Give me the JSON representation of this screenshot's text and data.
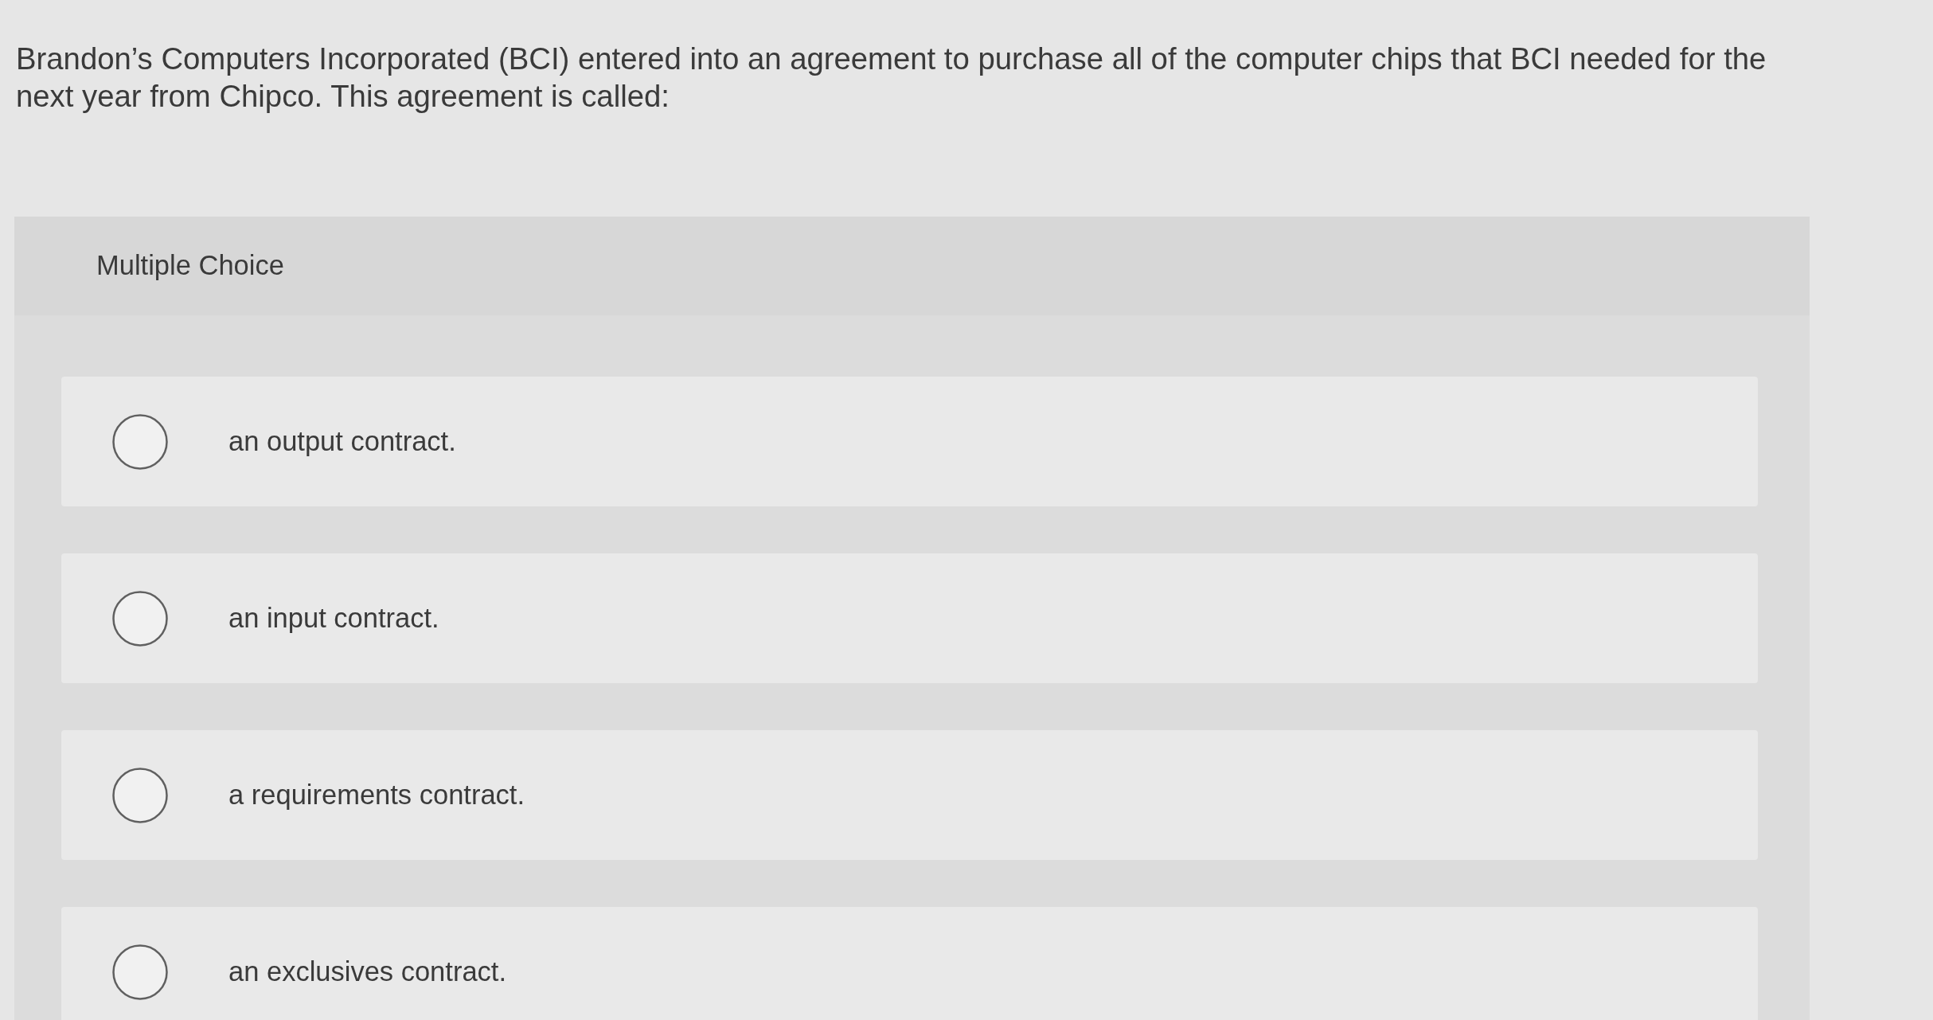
{
  "question": {
    "text": "Brandon’s Computers Incorporated (BCI) entered into an agreement to purchase all of the computer chips that BCI needed for the next year from Chipco. This agreement is called:"
  },
  "multiple_choice": {
    "label": "Multiple Choice",
    "options": [
      {
        "text": "an output contract.",
        "selected": false
      },
      {
        "text": "an input contract.",
        "selected": false
      },
      {
        "text": "a requirements contract.",
        "selected": false
      },
      {
        "text": "an exclusives contract.",
        "selected": false
      }
    ]
  }
}
